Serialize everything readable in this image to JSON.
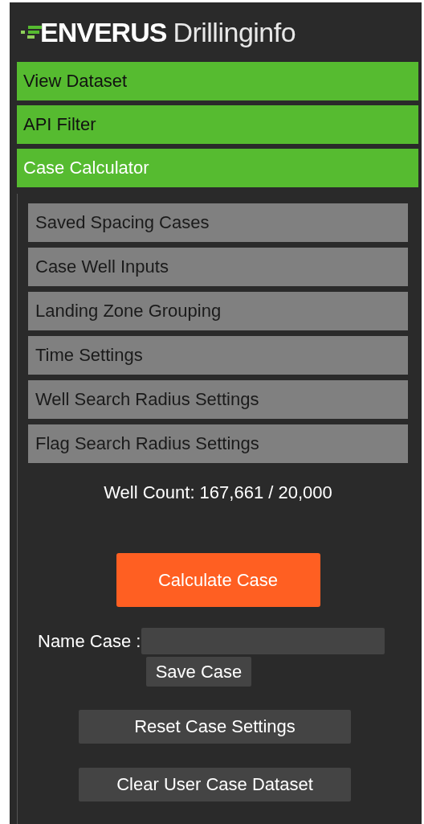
{
  "logo": {
    "brand": "ENVERUS",
    "product": "Drillinginfo"
  },
  "sections": [
    {
      "label": "View Dataset",
      "expanded": false
    },
    {
      "label": "API Filter",
      "expanded": false
    },
    {
      "label": "Case Calculator",
      "expanded": true
    }
  ],
  "case_calculator": {
    "items": [
      "Saved Spacing Cases",
      "Case Well Inputs",
      "Landing Zone Grouping",
      "Time Settings",
      "Well Search Radius Settings",
      "Flag Search Radius Settings"
    ],
    "well_count": "Well Count: 167,661 / 20,000",
    "calculate_button": "Calculate Case",
    "name_label": "Name Case :",
    "save_button": "Save Case",
    "reset_button": "Reset Case Settings",
    "clear_button": "Clear User Case Dataset"
  }
}
